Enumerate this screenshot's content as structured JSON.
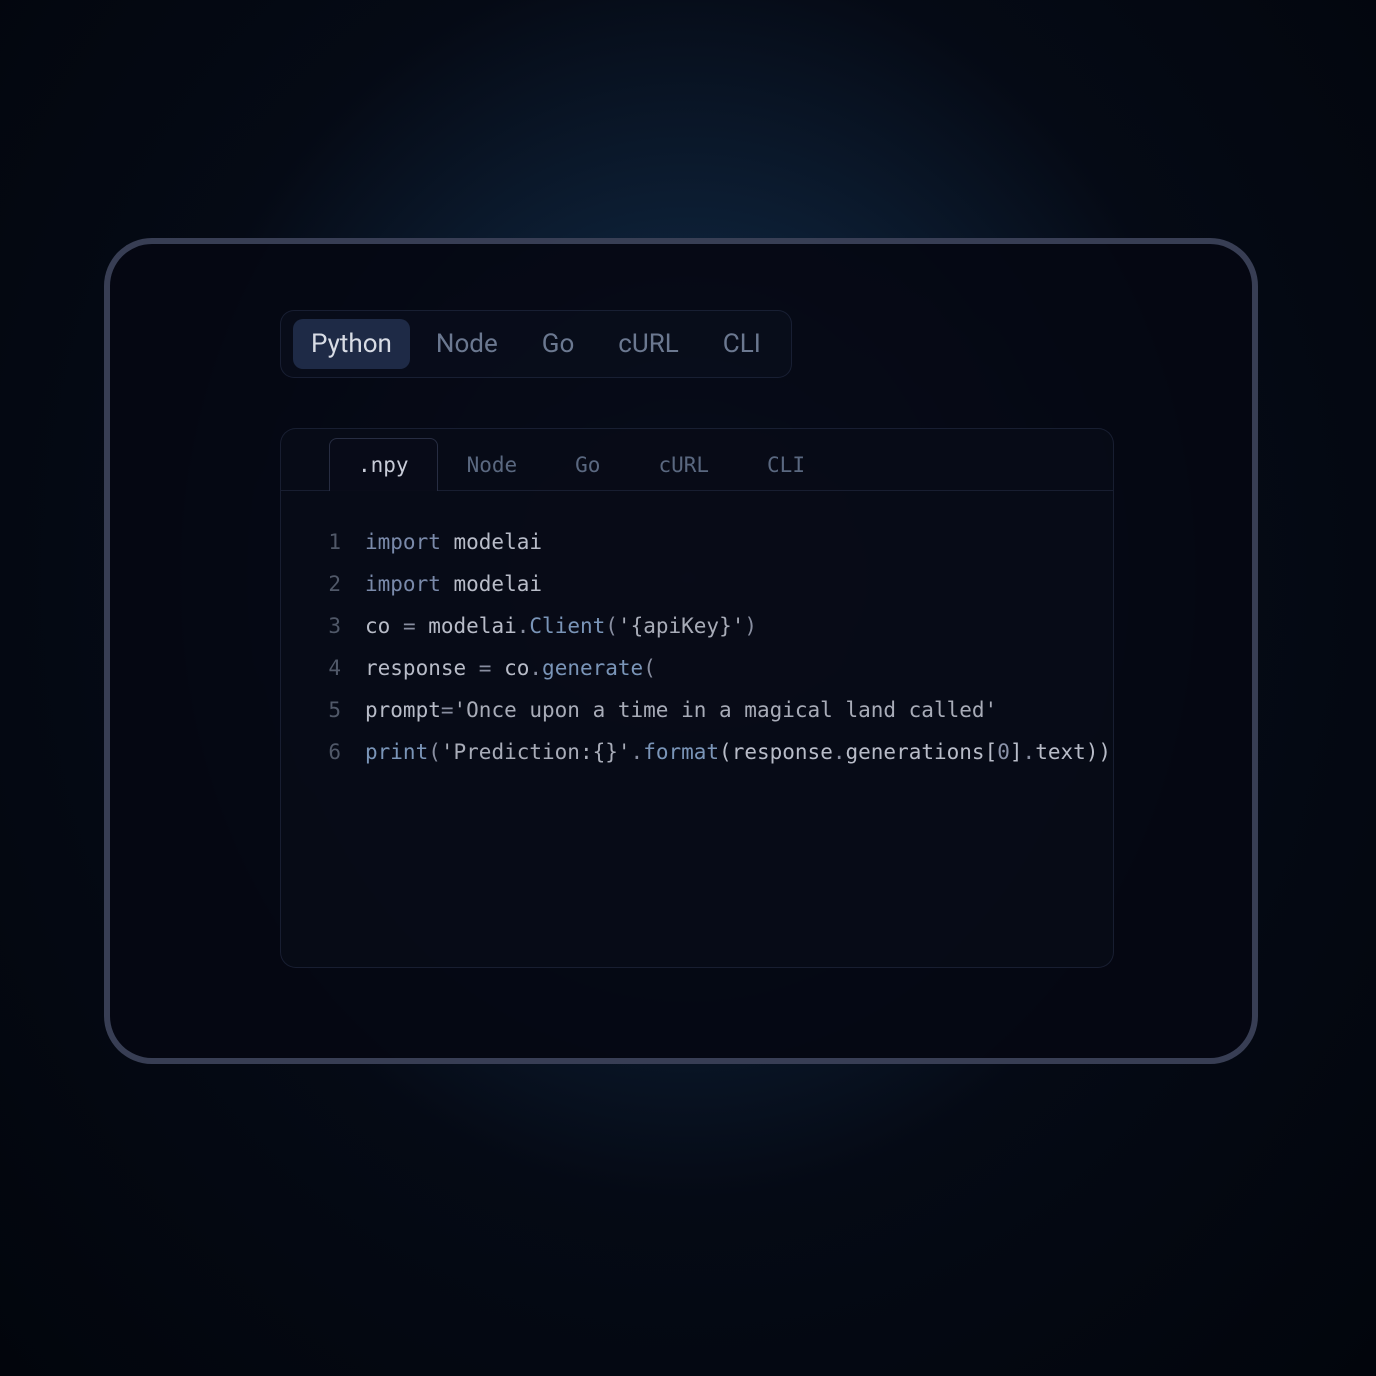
{
  "outer_tabs": [
    {
      "label": "Python",
      "active": true
    },
    {
      "label": "Node",
      "active": false
    },
    {
      "label": "Go",
      "active": false
    },
    {
      "label": "cURL",
      "active": false
    },
    {
      "label": "CLI",
      "active": false
    }
  ],
  "inner_tabs": [
    {
      "label": ".npy",
      "active": true
    },
    {
      "label": "Node",
      "active": false
    },
    {
      "label": "Go",
      "active": false
    },
    {
      "label": "cURL",
      "active": false
    },
    {
      "label": "CLI",
      "active": false
    }
  ],
  "code": {
    "lines": [
      {
        "num": "1",
        "tokens": [
          {
            "t": "import",
            "c": "kw"
          },
          {
            "t": " modelai",
            "c": "var"
          }
        ]
      },
      {
        "num": "2",
        "tokens": [
          {
            "t": "import",
            "c": "kw"
          },
          {
            "t": " modelai",
            "c": "var"
          }
        ]
      },
      {
        "num": "3",
        "tokens": [
          {
            "t": "co ",
            "c": "var"
          },
          {
            "t": "=",
            "c": "punct"
          },
          {
            "t": " modelai",
            "c": "var"
          },
          {
            "t": ".",
            "c": "punct"
          },
          {
            "t": "Client",
            "c": "fn"
          },
          {
            "t": "(",
            "c": "punct"
          },
          {
            "t": "'{apiKey}'",
            "c": "str"
          },
          {
            "t": ")",
            "c": "punct"
          }
        ]
      },
      {
        "num": "4",
        "tokens": [
          {
            "t": "response ",
            "c": "var"
          },
          {
            "t": "=",
            "c": "punct"
          },
          {
            "t": " co",
            "c": "var"
          },
          {
            "t": ".",
            "c": "punct"
          },
          {
            "t": "generate",
            "c": "fn"
          },
          {
            "t": "(",
            "c": "punct"
          }
        ]
      },
      {
        "num": "5",
        "tokens": [
          {
            "t": "prompt",
            "c": "var"
          },
          {
            "t": "=",
            "c": "punct"
          },
          {
            "t": "'Once upon a time in a magical land called'",
            "c": "str"
          }
        ]
      },
      {
        "num": "6",
        "tokens": [
          {
            "t": "print",
            "c": "fn"
          },
          {
            "t": "(",
            "c": "punct"
          },
          {
            "t": "'Prediction:{}'",
            "c": "str"
          },
          {
            "t": ".",
            "c": "punct"
          },
          {
            "t": "format",
            "c": "fn"
          },
          {
            "t": "(response",
            "c": "var"
          },
          {
            "t": ".",
            "c": "punct"
          },
          {
            "t": "generations[",
            "c": "var"
          },
          {
            "t": "0",
            "c": "num"
          },
          {
            "t": "]",
            "c": "var"
          },
          {
            "t": ".",
            "c": "punct"
          },
          {
            "t": "text))",
            "c": "var"
          }
        ]
      }
    ]
  }
}
